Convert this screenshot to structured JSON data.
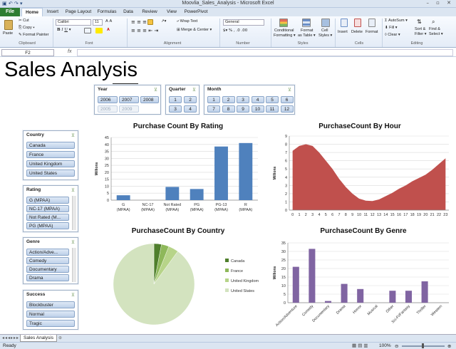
{
  "window": {
    "title": "Moovlia_Sales_Analysis  -  Microsoft Excel",
    "controls": "–  ▫  ✕"
  },
  "ribbon": {
    "file_tab": "File",
    "tabs": [
      "Home",
      "Insert",
      "Page Layout",
      "Formulas",
      "Data",
      "Review",
      "View",
      "PowerPivot"
    ],
    "clipboard": {
      "paste": "Paste",
      "cut": "Cut",
      "copy": "Copy ▾",
      "format_painter": "Format Painter",
      "label": "Clipboard"
    },
    "font": {
      "name": "Calibri",
      "size": "11",
      "label": "Font"
    },
    "alignment": {
      "wrap": "Wrap Text",
      "merge": "Merge & Center ▾",
      "label": "Alignment"
    },
    "number": {
      "format": "General",
      "label": "Number"
    },
    "styles": {
      "conditional": "Conditional",
      "conditional2": "Formatting ▾",
      "format_table": "Format",
      "format_table2": "as Table ▾",
      "cell_styles": "Cell",
      "cell_styles2": "Styles ▾",
      "label": "Styles"
    },
    "cells": {
      "insert": "Insert",
      "delete": "Delete",
      "format": "Format",
      "label": "Cells"
    },
    "editing": {
      "autosum": "AutoSum ▾",
      "fill": "Fill ▾",
      "clear": "Clear ▾",
      "sort": "Sort &",
      "sort2": "Filter ▾",
      "find": "Find &",
      "find2": "Select ▾",
      "label": "Editing"
    }
  },
  "formula_bar": {
    "name_box": "F2",
    "fx": "fx"
  },
  "sheet": {
    "title": "Sales Analysis"
  },
  "slicers": {
    "year": {
      "header": "Year",
      "items": [
        "2006",
        "2007",
        "2008",
        "2005",
        "2009"
      ]
    },
    "quarter": {
      "header": "Quarter",
      "items": [
        "1",
        "2",
        "3",
        "4"
      ]
    },
    "month": {
      "header": "Month",
      "items": [
        "1",
        "2",
        "3",
        "4",
        "5",
        "6",
        "7",
        "8",
        "9",
        "10",
        "11",
        "12"
      ]
    },
    "country": {
      "header": "Country",
      "items": [
        "Canada",
        "France",
        "United Kingdom",
        "United States"
      ]
    },
    "rating": {
      "header": "Rating",
      "items": [
        "G (MPAA)",
        "NC-17 (MPAA)",
        "Not Rated (M...",
        "PG (MPAA)"
      ]
    },
    "genre": {
      "header": "Genre",
      "items": [
        "Action/Adve...",
        "Comedy",
        "Documentary",
        "Drama"
      ]
    },
    "success": {
      "header": "Success",
      "items": [
        "Blockbuster",
        "Normal",
        "Tragic"
      ]
    }
  },
  "colors": {
    "bar_blue": "#4f81bd",
    "area_red": "#c0504d",
    "purple": "#8064a2",
    "pie_main": "#d3e3bf",
    "pie_dark": "#4f7f2c",
    "pie_mid": "#8eb85a",
    "pie_light": "#b7d489"
  },
  "chart_data": [
    {
      "type": "bar",
      "title": "Purchase Count By Rating",
      "ylabel": "Millions",
      "categories": [
        "G (MPAA)",
        "NC-17 (MPAA)",
        "Not Rated (MPAA)",
        "PG (MPAA)",
        "PG-13 (MPAA)",
        "R (MPAA)"
      ],
      "values": [
        3.5,
        0,
        9.5,
        8,
        38.5,
        41
      ],
      "ylim": [
        0,
        45
      ],
      "yticks": [
        0,
        5,
        10,
        15,
        20,
        25,
        30,
        35,
        40,
        45
      ],
      "grid": true
    },
    {
      "type": "area",
      "title": "PurchaseCount By Hour",
      "ylabel": "Millions",
      "x": [
        0,
        1,
        2,
        3,
        4,
        5,
        6,
        7,
        8,
        9,
        10,
        11,
        12,
        13,
        14,
        15,
        16,
        17,
        18,
        19,
        20,
        21,
        22,
        23
      ],
      "values": [
        7.2,
        7.8,
        8.0,
        7.8,
        7.0,
        6.0,
        5.0,
        3.8,
        2.8,
        2.0,
        1.4,
        1.15,
        1.1,
        1.3,
        1.7,
        2.1,
        2.6,
        3.0,
        3.5,
        3.9,
        4.3,
        4.9,
        5.6,
        6.3
      ],
      "ylim": [
        0,
        9
      ],
      "yticks": [
        0,
        1,
        2,
        3,
        4,
        5,
        6,
        7,
        8,
        9
      ],
      "grid": true
    },
    {
      "type": "pie",
      "title": "PurchaseCount By Country",
      "labels": [
        "Canada",
        "France",
        "United Kingdom",
        "United States"
      ],
      "values": [
        3,
        3,
        4,
        90
      ],
      "legend": "right"
    },
    {
      "type": "bar",
      "title": "PurchaseCount By Genre",
      "ylabel": "Millions",
      "categories": [
        "Action/Adventure",
        "Comedy",
        "Documentary",
        "Drama",
        "Horror",
        "Musical",
        "Other",
        "Sci-Fi/Fantasy",
        "Thriller",
        "Western"
      ],
      "values": [
        21,
        31.5,
        1,
        11,
        8,
        0,
        7,
        7,
        12.5,
        0
      ],
      "ylim": [
        0,
        35
      ],
      "yticks": [
        0,
        5,
        10,
        15,
        20,
        25,
        30,
        35
      ],
      "grid": true
    }
  ],
  "sheet_tabs": {
    "active": "Sales Analysis"
  },
  "status": {
    "ready": "Ready",
    "zoom": "100%"
  }
}
